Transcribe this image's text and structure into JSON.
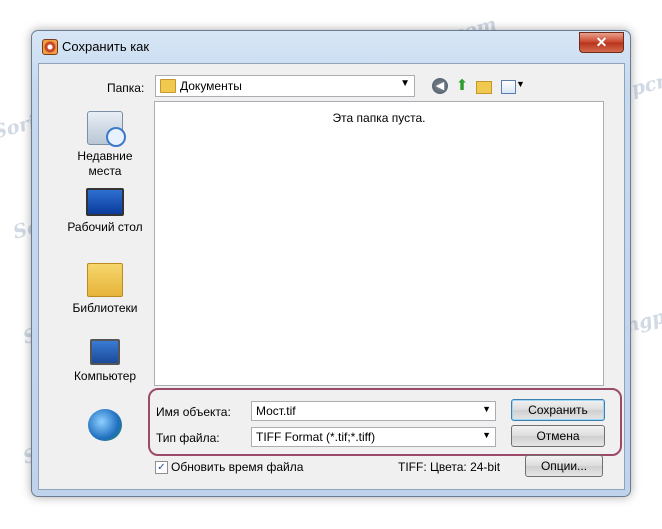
{
  "window": {
    "title": "Сохранить как",
    "close_symbol": "✕"
  },
  "folder_row": {
    "label": "Папка:",
    "current_folder": "Документы"
  },
  "toolbar": {
    "icons": [
      "back-icon",
      "up-folder-icon",
      "new-folder-icon",
      "views-menu-icon"
    ]
  },
  "places": [
    {
      "label": "Недавние места",
      "icon": "recent-places-icon"
    },
    {
      "label": "Рабочий стол",
      "icon": "desktop-icon"
    },
    {
      "label": "Библиотеки",
      "icon": "libraries-icon"
    },
    {
      "label": "Компьютер",
      "icon": "computer-icon"
    },
    {
      "label": "",
      "icon": "network-icon"
    }
  ],
  "file_area": {
    "empty_message": "Эта папка пуста."
  },
  "save_fields": {
    "name_label": "Имя объекта:",
    "name_value": "Мост.tif",
    "type_label": "Тип файла:",
    "type_value": "TIFF Format (*.tif;*.tiff)"
  },
  "buttons": {
    "save": "Сохранить",
    "cancel": "Отмена",
    "options": "Опции..."
  },
  "bottom": {
    "update_time_label": "Обновить время файла",
    "update_time_checked": true,
    "tiff_info": "TIFF: Цвета: 24-bit"
  },
  "watermark": "Soringpcrepair.com",
  "colors": {
    "highlight_border": "#9c4a6a",
    "default_button_border": "#3c7fb1"
  }
}
